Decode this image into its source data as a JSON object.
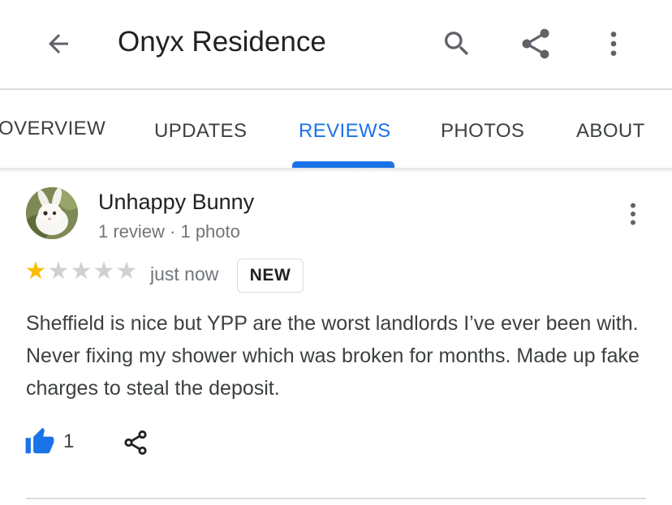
{
  "appbar": {
    "title": "Onyx Residence",
    "icons": {
      "back": "arrow-back-icon",
      "search": "search-icon",
      "share": "share-icon",
      "more": "more-vert-icon"
    }
  },
  "tabs": [
    {
      "label": "OVERVIEW",
      "active": false
    },
    {
      "label": "UPDATES",
      "active": false
    },
    {
      "label": "REVIEWS",
      "active": true
    },
    {
      "label": "PHOTOS",
      "active": false
    },
    {
      "label": "ABOUT",
      "active": false
    }
  ],
  "review": {
    "reviewer_name": "Unhappy Bunny",
    "reviewer_meta": "1 review · 1 photo",
    "rating": 1,
    "max_rating": 5,
    "time": "just now",
    "badge": "NEW",
    "text": "Sheffield is nice but YPP are the worst landlords I’ve ever been with. Never fixing my shower which was broken for months. Made up fake charges to steal the deposit.",
    "likes": "1"
  },
  "colors": {
    "accent": "#1a73e8",
    "star_filled": "#fbbc04",
    "star_empty": "#d0d0d0",
    "text_primary": "#202124",
    "text_secondary": "#70757a"
  }
}
